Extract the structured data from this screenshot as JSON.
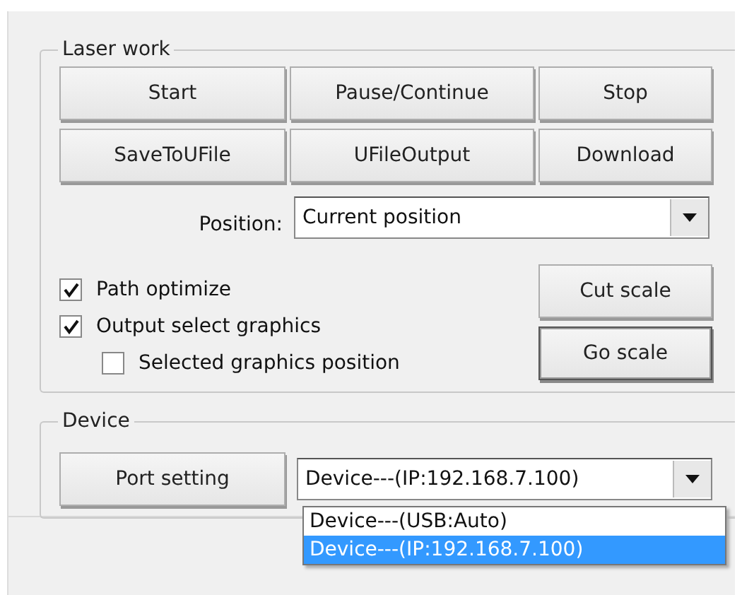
{
  "laser_work": {
    "title": "Laser work",
    "buttons": [
      {
        "label": "Start",
        "default": false
      },
      {
        "label": "Pause/Continue",
        "default": false
      },
      {
        "label": "Stop",
        "default": false
      },
      {
        "label": "SaveToUFile",
        "default": false
      },
      {
        "label": "UFileOutput",
        "default": false
      },
      {
        "label": "Download",
        "default": false
      }
    ],
    "position": {
      "label": "Position:",
      "value": "Current position"
    },
    "options": [
      {
        "label": "Path optimize",
        "checked": true
      },
      {
        "label": "Output select graphics",
        "checked": true,
        "children": [
          {
            "label": "Selected graphics position",
            "checked": false
          }
        ]
      }
    ],
    "scale_buttons": [
      {
        "label": "Cut scale",
        "default": false
      },
      {
        "label": "Go scale",
        "default": true
      }
    ]
  },
  "device": {
    "title": "Device",
    "port_button": {
      "label": "Port setting",
      "default": false
    },
    "value": "Device---(IP:192.168.7.100)",
    "dropdown": [
      {
        "label": "Device---(USB:Auto)",
        "selected": false
      },
      {
        "label": "Device---(IP:192.168.7.100)",
        "selected": true
      }
    ]
  }
}
